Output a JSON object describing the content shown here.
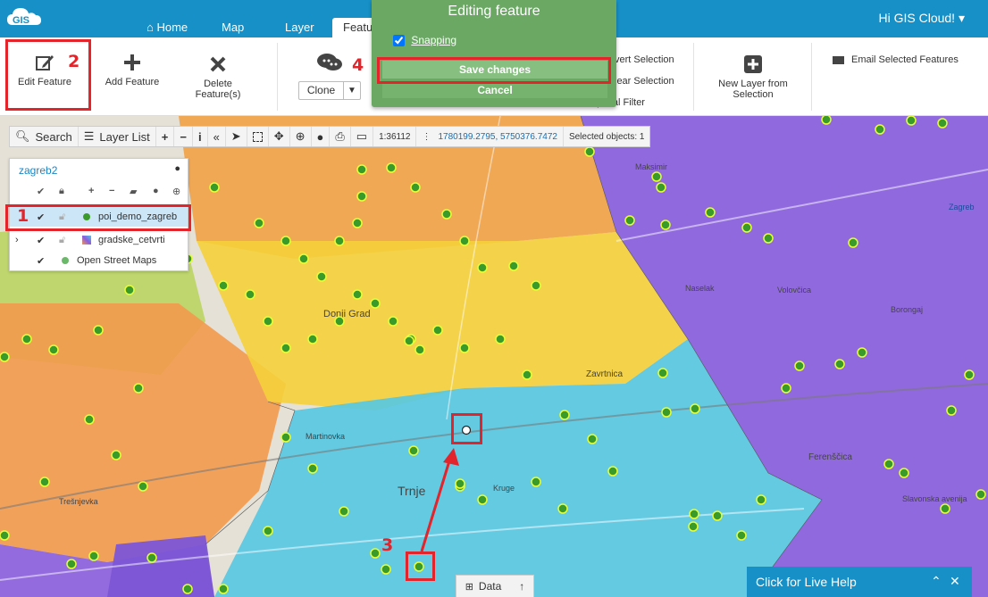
{
  "app": {
    "logo_text": "GIS",
    "greeting": "Hi GIS Cloud!"
  },
  "nav": {
    "tabs": [
      "Home",
      "Map",
      "Layer",
      "Featu"
    ]
  },
  "ribbon": {
    "edit_feature": "Edit Feature",
    "add_feature": "Add Feature",
    "delete_feature_line1": "Delete",
    "delete_feature_line2": "Feature(s)",
    "clone": "Clone",
    "invert_selection": "vert Selection",
    "clear_selection": "lear Selection",
    "spatial_filter": "patial Filter",
    "new_layer_line1": "New Layer from",
    "new_layer_line2": "Selection",
    "email_selected": "Email Selected Features"
  },
  "edit_dialog": {
    "title": "Editing feature",
    "snapping_label": "Snapping",
    "snapping_checked": true,
    "save": "Save changes",
    "cancel": "Cancel"
  },
  "toolbar": {
    "search": "Search",
    "layer_list": "Layer List",
    "scale": "1:36112",
    "coords": "1780199.2795, 5750376.7472",
    "selected": "Selected objects: 1"
  },
  "layer_panel": {
    "project": "zagreb2",
    "layers": [
      {
        "name": "poi_demo_zagreb",
        "selected": true,
        "dot_color": "#3a9a2a"
      },
      {
        "name": "gradske_cetvrti",
        "selected": false
      },
      {
        "name": "Open Street Maps",
        "selected": false
      }
    ]
  },
  "annotations": [
    "1",
    "2",
    "3",
    "4"
  ],
  "map_labels": {
    "donji_grad": "Donji Grad",
    "martinovka": "Martinovka",
    "tresnjevka": "Trešnjevka",
    "trnje": "Trnje",
    "kruge": "Kruge",
    "zavrtnica": "Zavrtnica",
    "ferenscica": "Ferenščica",
    "slavonska": "Slavonska avenija",
    "volovcica": "Volovčica",
    "naselak": "Naselak",
    "borongaj": "Borongaj",
    "maksimir": "Maksimir",
    "zagreb": "Zagreb"
  },
  "bottom": {
    "data": "Data",
    "live_help": "Click for Live Help"
  },
  "colors": {
    "brand": "#1690c6",
    "annotation": "#e3242b",
    "dialog": "#6aa863",
    "poi": "#3a9a2a"
  }
}
